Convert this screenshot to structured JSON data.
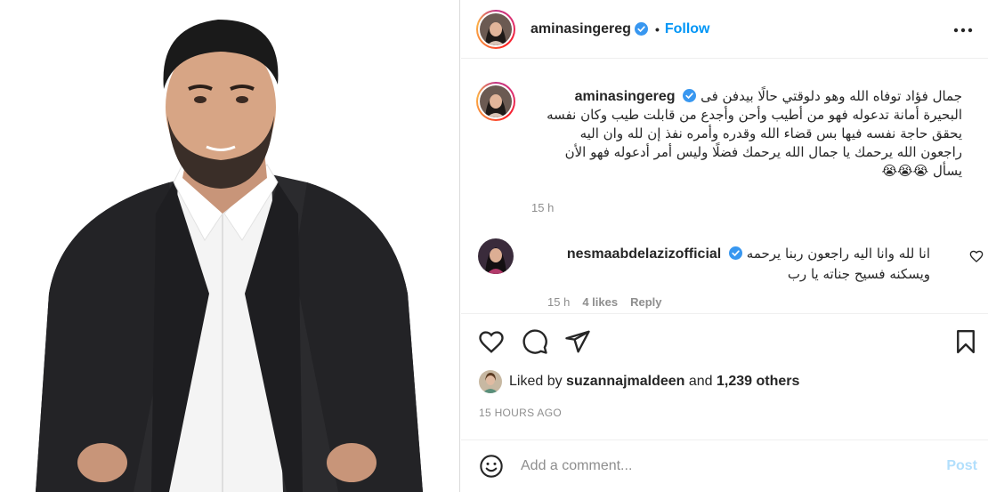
{
  "post": {
    "username": "aminasingereg",
    "follow_label": "Follow",
    "separator": "•",
    "caption_lines": [
      "جمال فؤاد توفاه الله وهو دلوقتي حالًا بيدفن فى",
      "البحيرة أمانة تدعوله فهو من أطيب وأحن وأجدع من قابلت طيب وكان نفسه",
      "يحقق حاجة نفسه فيها بس قضاء الله وقدره وأمره نفذ إن لله وان اليه",
      "راجعون الله يرحمك يا جمال الله يرحمك فضلًا وليس أمر أدعوله فهو الأن",
      "يسأل 😭😭😭"
    ],
    "caption_time": "15 h"
  },
  "comment": {
    "username": "nesmaabdelaziz official",
    "username_display": "nesmaabdelazizofficial",
    "lines": [
      "انا لله وانا اليه راجعون ربنا يرحمه",
      "ويسكنه فسيح جناته يا رب"
    ],
    "time": "15 h",
    "likes": "4 likes",
    "reply_label": "Reply"
  },
  "likes": {
    "prefix": "Liked by",
    "user": "suzannajmaldeen",
    "middle": "and",
    "count": "1,239 others"
  },
  "time_ago": "15 HOURS AGO",
  "add_comment": {
    "placeholder": "Add a comment...",
    "post_label": "Post"
  },
  "icons": {
    "like": "heart-icon",
    "comment": "comment-icon",
    "share": "share-icon",
    "save": "bookmark-icon",
    "more": "more-options-icon",
    "emoji": "emoji-icon",
    "verified": "verified-badge-icon"
  },
  "colors": {
    "accent": "#0095f6",
    "verified": "#3897f0",
    "muted": "#8e8e8e",
    "post_disabled": "#b2dffc"
  }
}
